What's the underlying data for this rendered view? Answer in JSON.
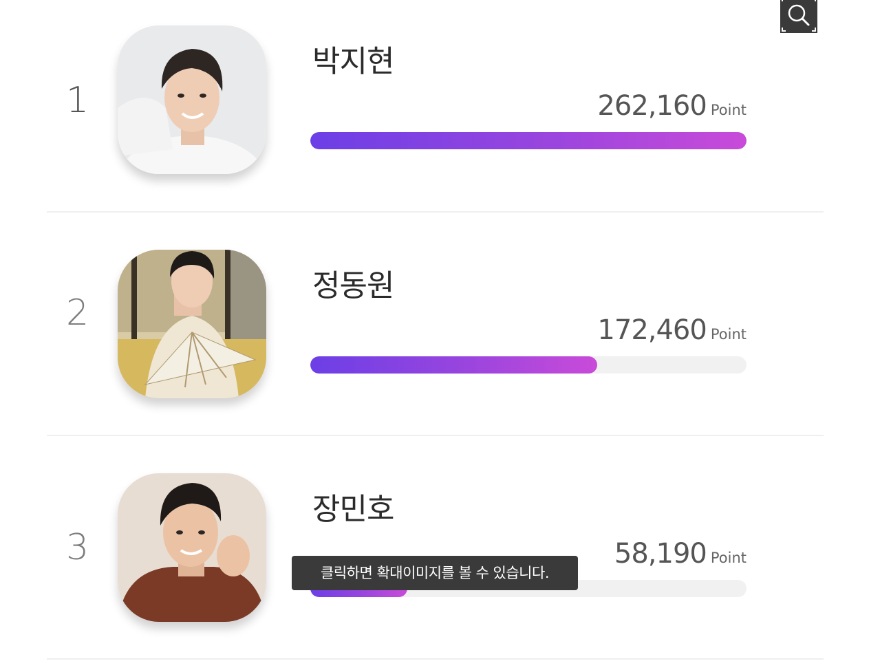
{
  "zoom_button": {
    "icon": "magnifier-icon"
  },
  "ranking": [
    {
      "rank": "1",
      "name": "박지현",
      "points": "262,160",
      "unit": "Point",
      "progress": 1.0
    },
    {
      "rank": "2",
      "name": "정동원",
      "points": "172,460",
      "unit": "Point",
      "progress": 0.6578
    },
    {
      "rank": "3",
      "name": "장민호",
      "points": "58,190",
      "unit": "Point",
      "progress": 0.222
    }
  ],
  "tooltip": {
    "text": "클릭하면 확대이미지를 볼 수 있습니다."
  },
  "colors": {
    "bar_gradient_start": "#6c3fe6",
    "bar_gradient_end": "#c94bd9",
    "bar_track": "#f1f1f1",
    "tooltip_bg": "#3a3a3a"
  }
}
